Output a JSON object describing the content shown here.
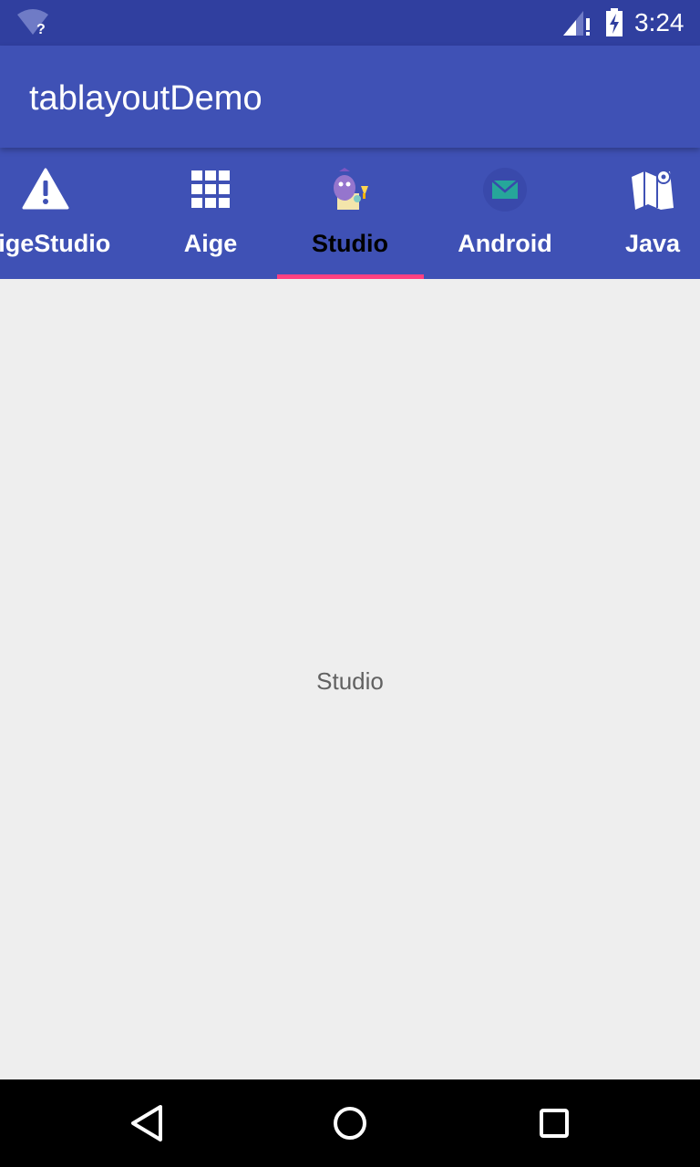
{
  "status_bar": {
    "time": "3:24",
    "wifi_icon": "wifi-unknown-icon",
    "signal_icon": "cell-signal-icon",
    "battery_icon": "battery-charging-icon"
  },
  "app_bar": {
    "title": "tablayoutDemo"
  },
  "tabs": [
    {
      "label": "AigeStudio",
      "icon": "warning-icon",
      "selected": false
    },
    {
      "label": "Aige",
      "icon": "grid-icon",
      "selected": false
    },
    {
      "label": "Studio",
      "icon": "mascot-icon",
      "selected": true
    },
    {
      "label": "Android",
      "icon": "mail-icon",
      "selected": false
    },
    {
      "label": "Java",
      "icon": "map-icon",
      "selected": false
    }
  ],
  "content": {
    "text": "Studio"
  },
  "nav_bar": {
    "back_icon": "back-icon",
    "home_icon": "home-icon",
    "recents_icon": "recents-icon"
  },
  "colors": {
    "primary": "#3F51B5",
    "primary_dark": "#303F9F",
    "accent": "#FF4081",
    "background": "#EEEEEE"
  }
}
